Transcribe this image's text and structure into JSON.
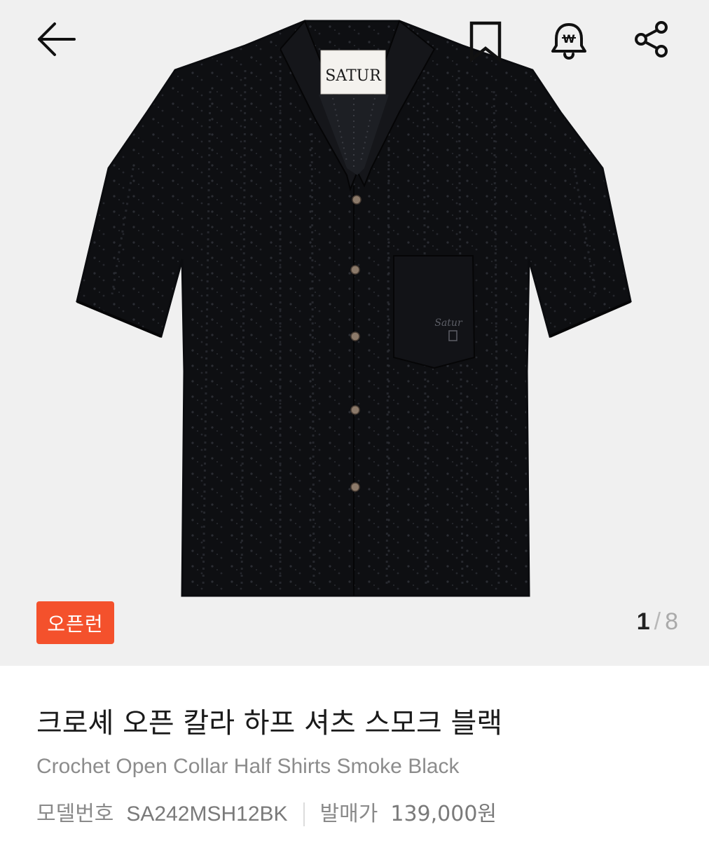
{
  "header": {
    "back_icon": "arrow-left-icon",
    "bookmark_icon": "bookmark-icon",
    "alert_icon": "price-alert-bell-icon",
    "share_icon": "share-icon"
  },
  "gallery": {
    "image_alt": "black crochet open collar half shirt",
    "label_text": "SATUR",
    "badge": "오픈런",
    "current_index": "1",
    "separator": "/",
    "total": "8"
  },
  "product": {
    "title_ko": "크로셰 오픈 칼라 하프 셔츠 스모크 블랙",
    "title_en": "Crochet Open Collar Half Shirts Smoke Black",
    "model_label": "모델번호",
    "model_value": "SA242MSH12BK",
    "release_price_label": "발매가",
    "release_price_value": "139,000원"
  },
  "colors": {
    "badge_bg": "#f4512c",
    "gallery_bg": "#f0f0f0",
    "shirt": "#0e0f12"
  }
}
